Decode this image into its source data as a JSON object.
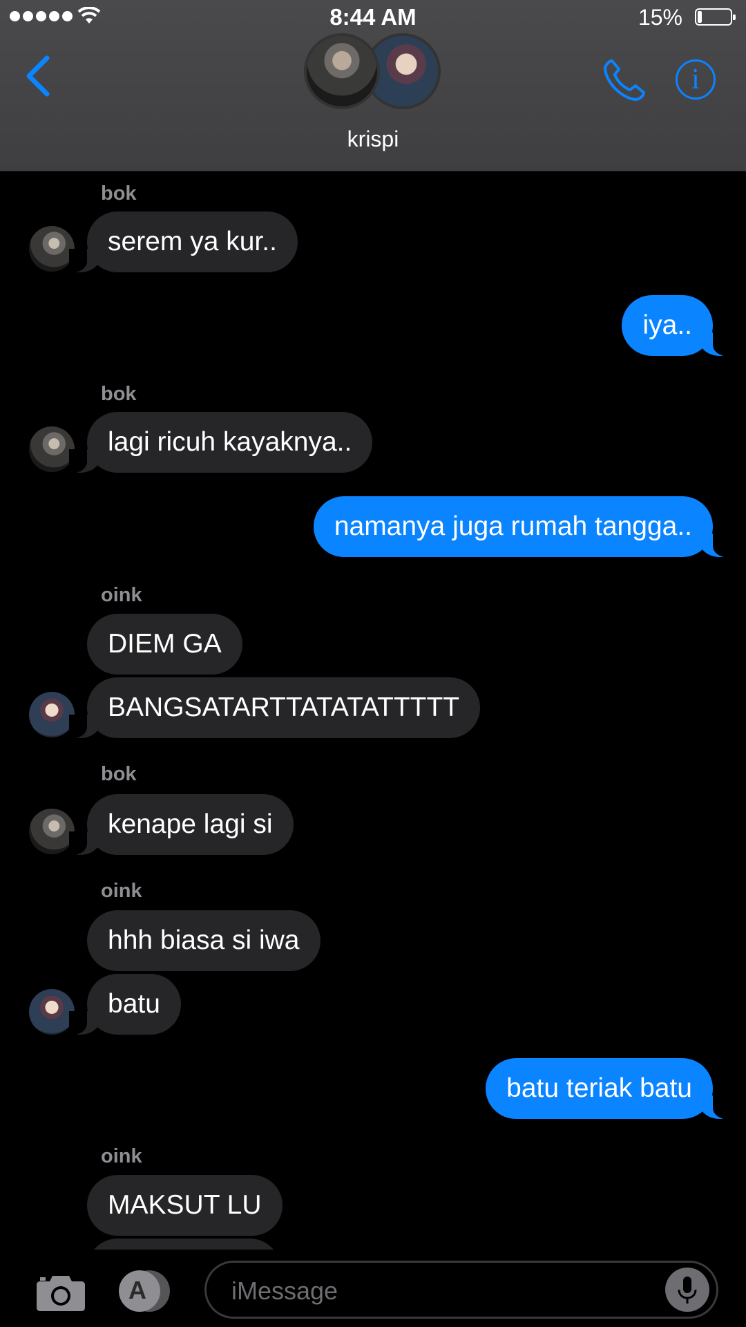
{
  "status_bar": {
    "time": "8:44 AM",
    "battery": "15%"
  },
  "header": {
    "contact_name": "krispi"
  },
  "messages": [
    {
      "sender": "bok",
      "text": "serem ya kur.."
    },
    {
      "text": "iya.."
    },
    {
      "sender": "bok",
      "text": "lagi ricuh kayaknya.."
    },
    {
      "text": "namanya juga rumah tangga.."
    },
    {
      "sender": "oink",
      "text": "DIEM GA"
    },
    {
      "text": "BANGSATARTTATATATTTTT"
    },
    {
      "sender": "bok",
      "text": "kenape lagi si"
    },
    {
      "sender": "oink",
      "text": "hhh biasa si iwa"
    },
    {
      "text": "batu"
    },
    {
      "text": "batu teriak batu"
    },
    {
      "sender": "oink",
      "text": "MAKSUT LU"
    }
  ],
  "input": {
    "placeholder": "iMessage"
  },
  "colors": {
    "accent": "#0a84ff",
    "incoming_bubble": "#262628",
    "background": "#000000"
  },
  "icons": [
    "signal-dots-icon",
    "wifi-icon",
    "battery-icon",
    "back-chevron-icon",
    "phone-icon",
    "info-icon",
    "camera-icon",
    "app-store-icon",
    "microphone-icon"
  ]
}
